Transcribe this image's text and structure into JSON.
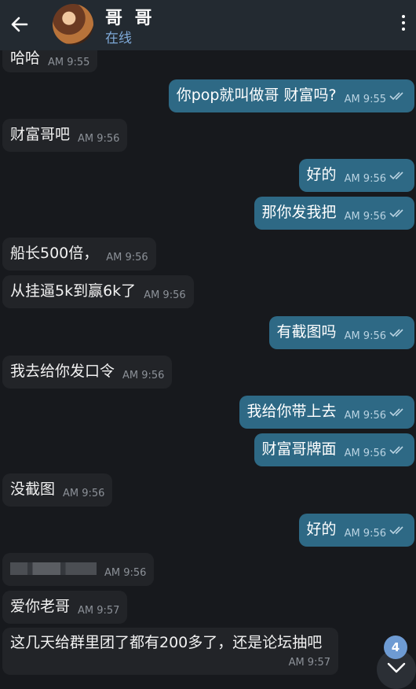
{
  "header": {
    "title": "哥 哥",
    "status": "在线"
  },
  "messages": [
    {
      "dir": "in",
      "text": "哈哈",
      "time": "AM 9:55"
    },
    {
      "dir": "out",
      "text": "你pop就叫做哥 财富吗?",
      "time": "AM 9:55"
    },
    {
      "dir": "in",
      "text": "财富哥吧",
      "time": "AM 9:56"
    },
    {
      "dir": "out",
      "text": "好的",
      "time": "AM 9:56"
    },
    {
      "dir": "out",
      "text": "那你发我把",
      "time": "AM 9:56"
    },
    {
      "dir": "in",
      "text": "船长500倍，",
      "time": "AM 9:56"
    },
    {
      "dir": "in",
      "text": "从挂逼5k到赢6k了",
      "time": "AM 9:56"
    },
    {
      "dir": "out",
      "text": "有截图吗",
      "time": "AM 9:56"
    },
    {
      "dir": "in",
      "text": "我去给你发口令",
      "time": "AM 9:56"
    },
    {
      "dir": "out",
      "text": "我给你带上去",
      "time": "AM 9:56"
    },
    {
      "dir": "out",
      "text": "财富哥牌面",
      "time": "AM 9:56"
    },
    {
      "dir": "in",
      "text": "没截图",
      "time": "AM 9:56"
    },
    {
      "dir": "out",
      "text": "好的",
      "time": "AM 9:56"
    },
    {
      "dir": "in",
      "text": "",
      "time": "AM 9:56"
    },
    {
      "dir": "in",
      "text": "爱你老哥",
      "time": "AM 9:57"
    },
    {
      "dir": "in",
      "text": "这几天给群里团了都有200多了，还是论坛抽吧",
      "time": "AM 9:57"
    }
  ],
  "unread_badge": "4",
  "colors": {
    "header": "#232a31",
    "background": "#17191d",
    "incoming": "#222428",
    "outgoing": "#2e6985",
    "status": "#7ea9d8",
    "badge": "#6e9bd3"
  },
  "icons": {
    "back": "arrow-left-icon",
    "menu": "more-vertical-icon",
    "read": "double-check-icon",
    "scroll": "chevron-down-icon"
  }
}
